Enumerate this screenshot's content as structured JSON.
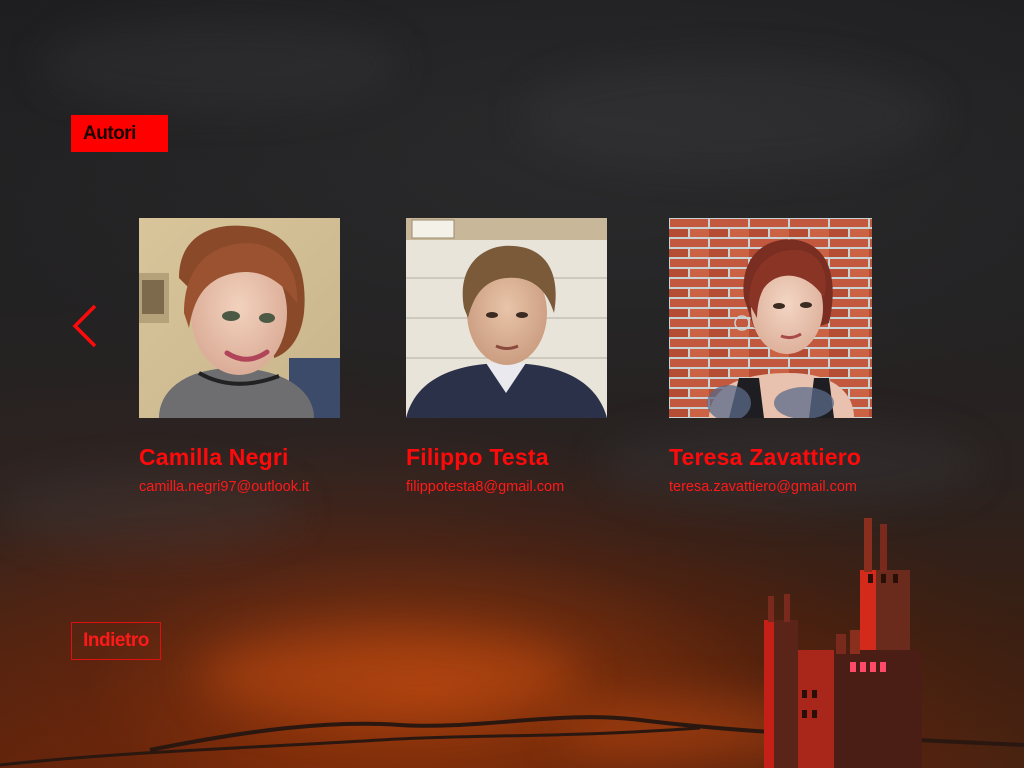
{
  "section": {
    "title": "Autori"
  },
  "carousel": {
    "prev_icon": "chevron-left-icon",
    "accent_color": "#ff0000"
  },
  "authors": [
    {
      "name": "Camilla Negri",
      "email": "camilla.negri97@outlook.it"
    },
    {
      "name": "Filippo Testa",
      "email": "filippotesta8@gmail.com"
    },
    {
      "name": "Teresa Zavattiero",
      "email": "teresa.zavattiero@gmail.com"
    }
  ],
  "footer": {
    "back_label": "Indietro"
  }
}
